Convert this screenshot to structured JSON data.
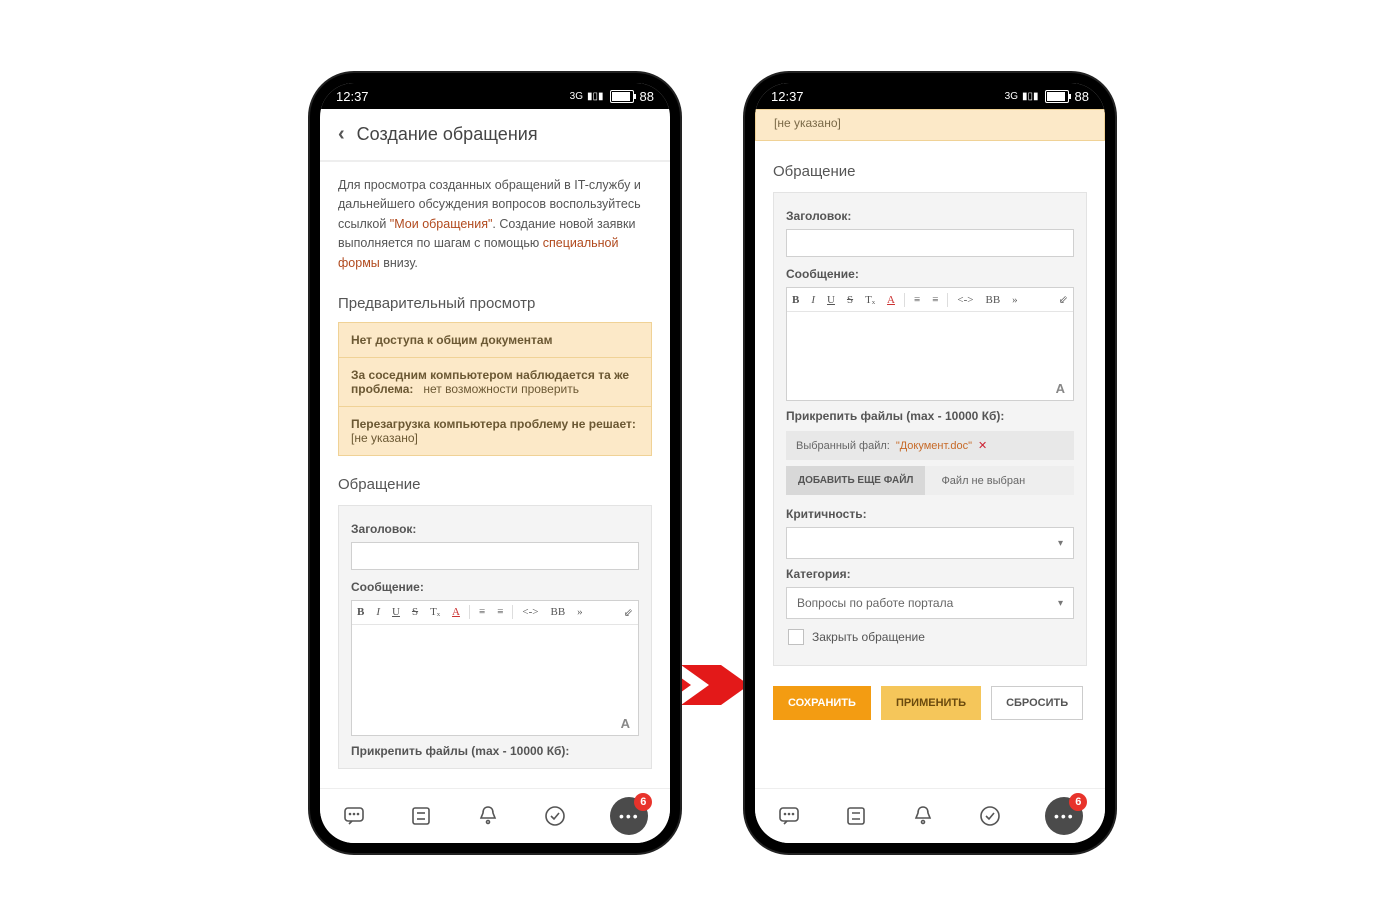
{
  "status": {
    "time": "12:37",
    "battery": "88",
    "signal": "3G"
  },
  "screen1": {
    "title": "Создание обращения",
    "intro_pre": "Для просмотра созданных обращений в IT-службу и дальнейшего обсуждения вопросов воспользуйтесь ссылкой ",
    "intro_link1": "\"Мои обращения\"",
    "intro_mid": ". Создание новой заявки выполняется по шагам с помощью ",
    "intro_link2": "специальной формы",
    "intro_post": " внизу.",
    "preview_heading": "Предварительный просмотр",
    "preview": {
      "r1": "Нет доступа к общим документам",
      "r2a": "За соседним компьютером наблюдается та же проблема:",
      "r2b": "нет возможности проверить",
      "r3a": "Перезагрузка компьютера проблему не решает:",
      "r3b": "[не указано]"
    },
    "form_heading": "Обращение",
    "field_title": "Заголовок:",
    "field_message": "Сообщение:",
    "attach_label_cut": "Прикрепить файлы (max - 10000 Кб):"
  },
  "screen2": {
    "top_note": "[не указано]",
    "form_heading": "Обращение",
    "field_title": "Заголовок:",
    "field_message": "Сообщение:",
    "attach_label": "Прикрепить файлы (max - 10000 Кб):",
    "selected_file_label": "Выбранный файл:",
    "selected_file_name": "\"Документ.doc\"",
    "add_file_btn": "ДОБАВИТЬ ЕЩЕ ФАЙЛ",
    "no_file": "Файл не выбран",
    "criticality_label": "Критичность:",
    "category_label": "Категория:",
    "category_value": "Вопросы по работе портала",
    "close_checkbox": "Закрыть обращение",
    "btn_save": "СОХРАНИТЬ",
    "btn_apply": "ПРИМЕНИТЬ",
    "btn_reset": "СБРОСИТЬ"
  },
  "toolbar": {
    "b": "B",
    "i": "I",
    "u": "U",
    "s": "S",
    "tx": "Tₓ",
    "a": "A",
    "ol": "≡",
    "ul": "≡",
    "code": "<->",
    "bb": "BB",
    "more": "»",
    "pin": "⇙"
  },
  "nav_badge": "6"
}
